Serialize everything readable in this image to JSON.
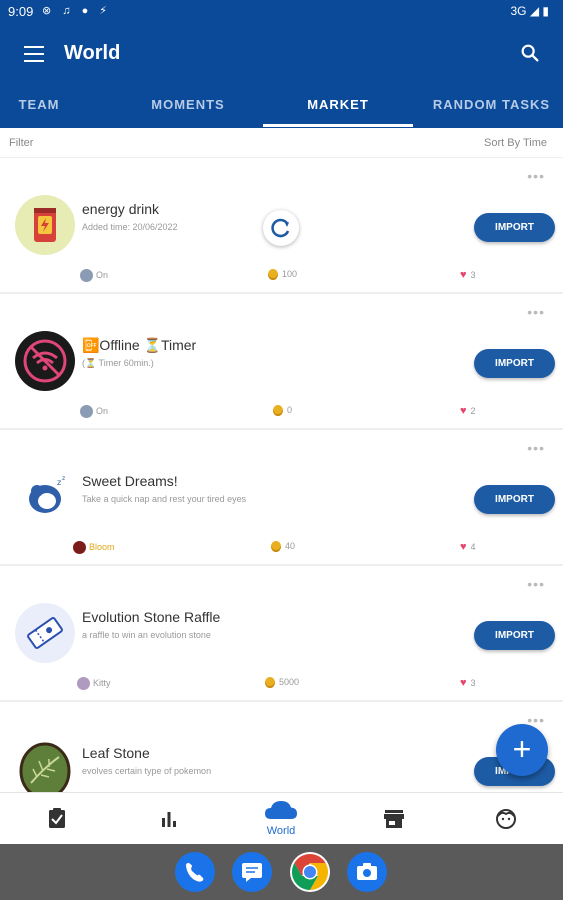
{
  "status_bar": {
    "time": "9:09",
    "network": "3G"
  },
  "app_bar": {
    "title": "World"
  },
  "tabs": [
    {
      "label": "TEAM",
      "active": false
    },
    {
      "label": "MOMENTS",
      "active": false
    },
    {
      "label": "MARKET",
      "active": true
    },
    {
      "label": "RANDOM TASKS",
      "active": false
    }
  ],
  "filter": {
    "left": "Filter",
    "right": "Sort By Time"
  },
  "items": [
    {
      "title": "energy drink",
      "desc": "Added time: 20/06/2022",
      "author": "On",
      "coins": "100",
      "likes": "3",
      "button": "IMPORT"
    },
    {
      "title": "📴Offline ⏳Timer",
      "desc": "(⏳ Timer 60min.)",
      "author": "On",
      "coins": "0",
      "likes": "2",
      "button": "IMPORT"
    },
    {
      "title": "Sweet Dreams!",
      "desc": "Take a quick nap and rest your tired eyes",
      "author": "Bloom",
      "coins": "40",
      "likes": "4",
      "button": "IMPORT"
    },
    {
      "title": "Evolution Stone Raffle",
      "desc": "a raffle to win an evolution stone",
      "author": "Kitty",
      "coins": "5000",
      "likes": "3",
      "button": "IMPORT"
    },
    {
      "title": "Leaf Stone",
      "desc": "evolves certain type of pokemon",
      "author": "",
      "coins": "",
      "likes": "",
      "button": "IMPORT"
    }
  ],
  "bottom_nav": {
    "world_label": "World"
  },
  "colors": {
    "primary": "#0b4a99",
    "accent": "#1e6ad1",
    "button": "#1d5ca5"
  }
}
